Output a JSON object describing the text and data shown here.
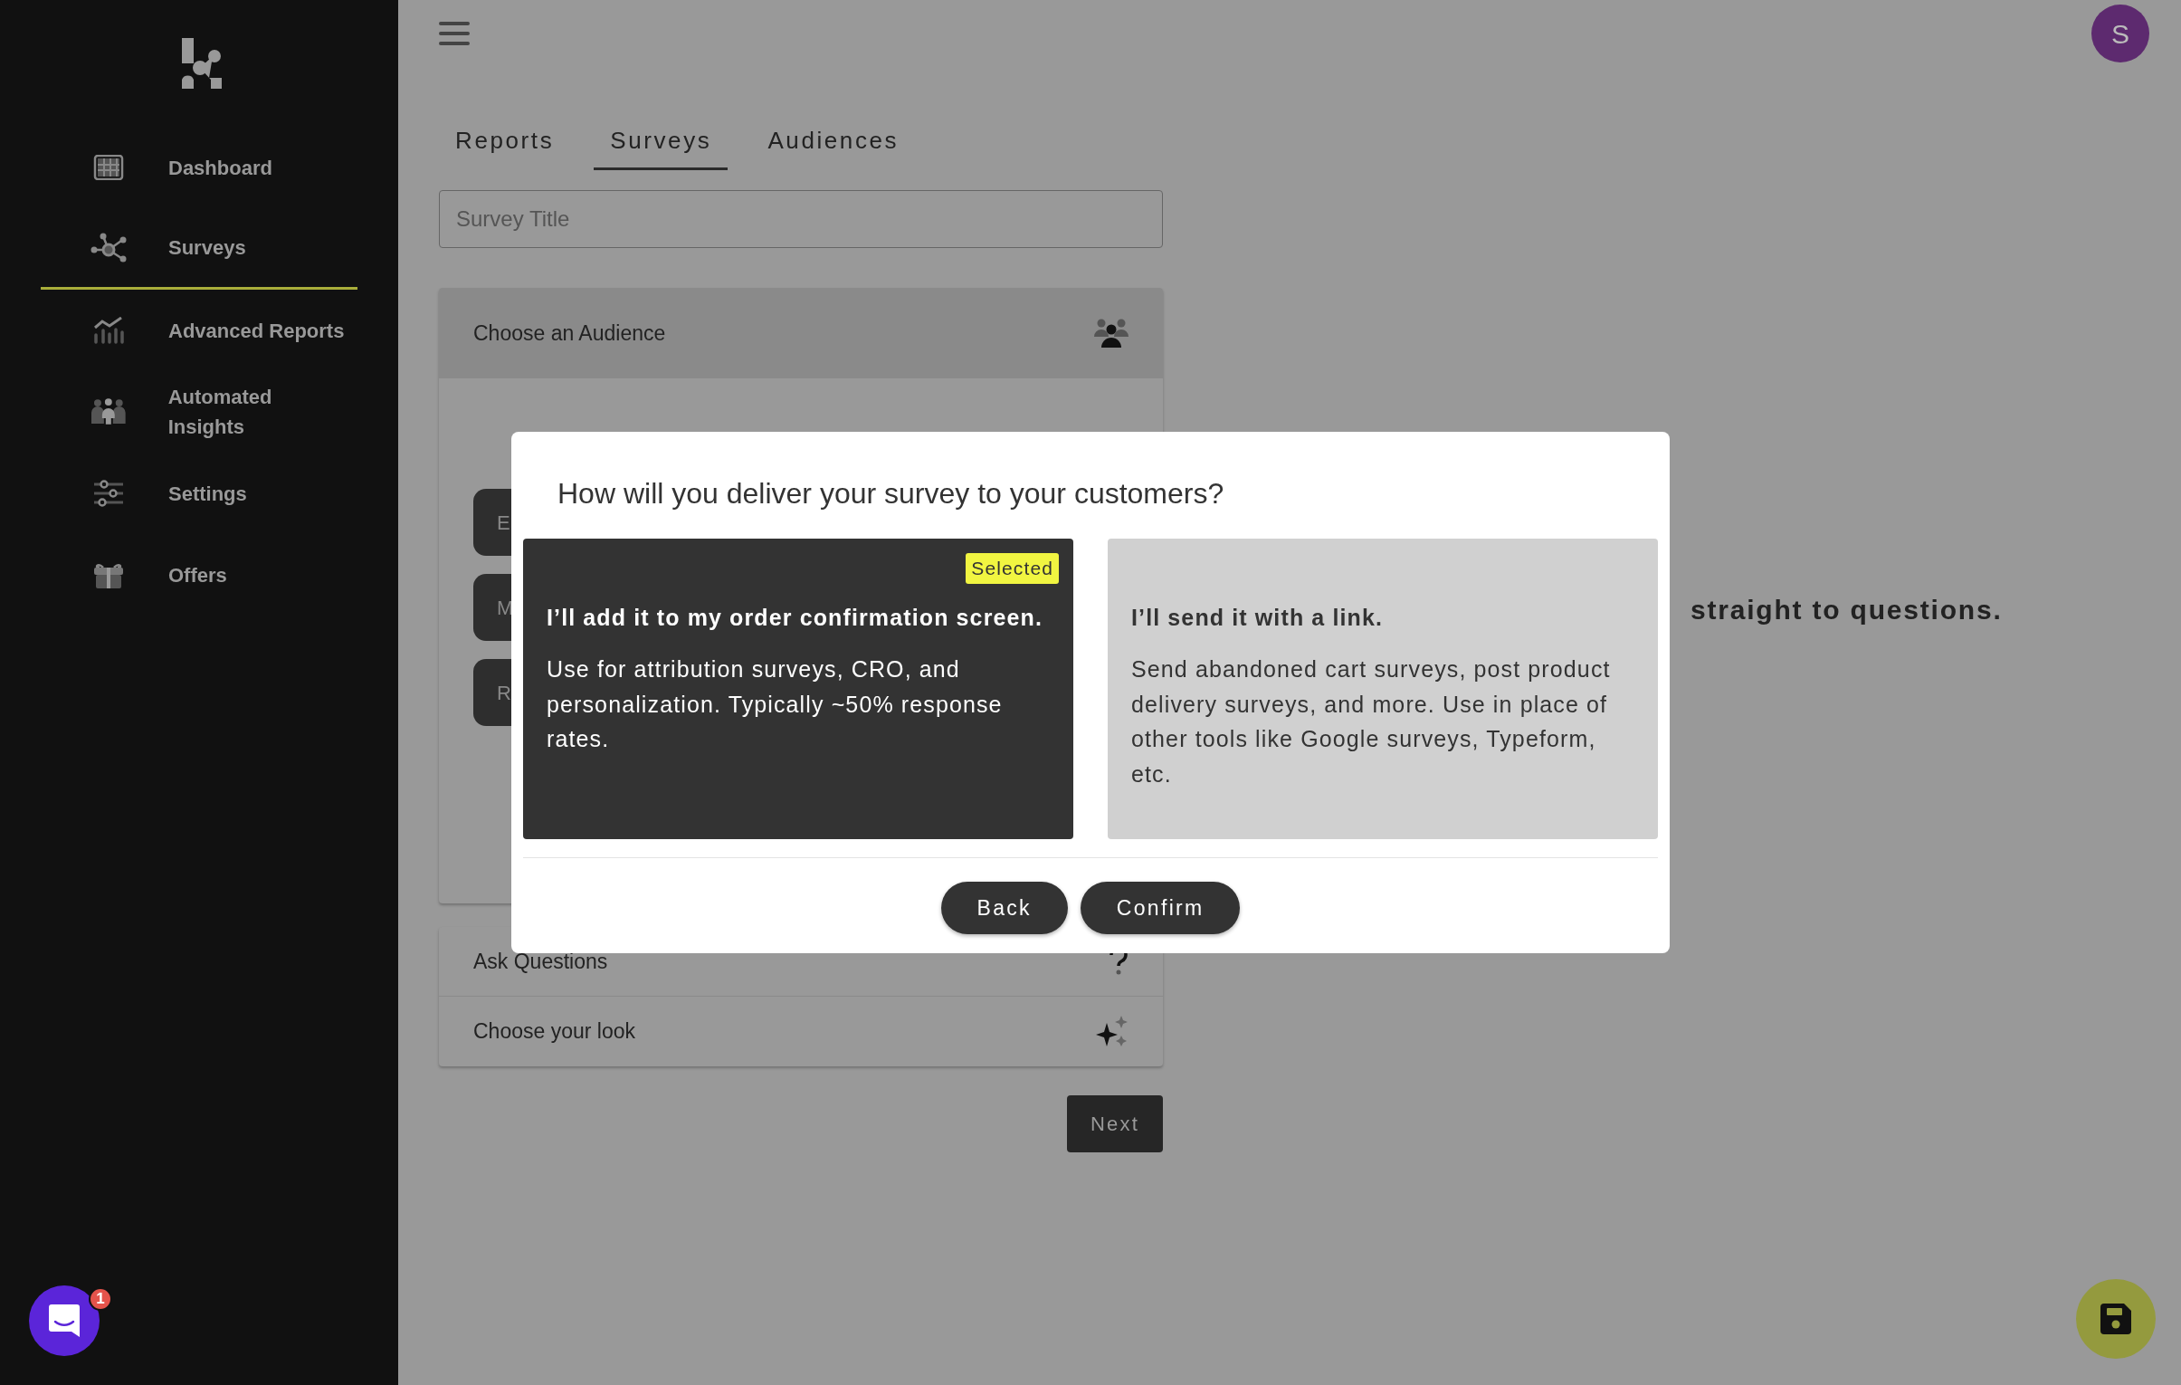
{
  "sidebar": {
    "items": [
      {
        "label": "Dashboard",
        "selected": false
      },
      {
        "label": "Surveys",
        "selected": true
      },
      {
        "label": "Advanced Reports",
        "selected": false
      },
      {
        "label": "Automated Insights",
        "selected": false
      },
      {
        "label": "Settings",
        "selected": false
      },
      {
        "label": "Offers",
        "selected": false
      }
    ]
  },
  "top_bar": {
    "avatar": "S"
  },
  "tabs": [
    {
      "label": "Reports",
      "selected": false
    },
    {
      "label": "Surveys",
      "selected": true
    },
    {
      "label": "Audiences",
      "selected": false
    }
  ],
  "survey_title": {
    "placeholder": "Survey Title"
  },
  "steps": [
    {
      "label": "Choose an Audience",
      "expanded": true,
      "options": [
        "E",
        "M",
        "R"
      ]
    },
    {
      "label": "Ask Questions",
      "expanded": false
    },
    {
      "label": "Choose your look",
      "expanded": false
    }
  ],
  "next_button": "Next",
  "side_note": "straight to questions.",
  "modal": {
    "title": "How will you deliver your survey to your customers?",
    "options": [
      {
        "selected": true,
        "badge": "Selected",
        "heading": "I’ll add it to my order confirmation screen.",
        "description": "Use for attribution surveys, CRO, and personalization. Typically ~50% response rates."
      },
      {
        "selected": false,
        "heading": "I’ll send it with a link.",
        "description": "Send abandoned cart surveys, post product delivery surveys, and more. Use in place of other tools like Google surveys, Typeform, etc."
      }
    ],
    "buttons": [
      "Back",
      "Confirm"
    ]
  },
  "chat": {
    "badge": "1"
  }
}
